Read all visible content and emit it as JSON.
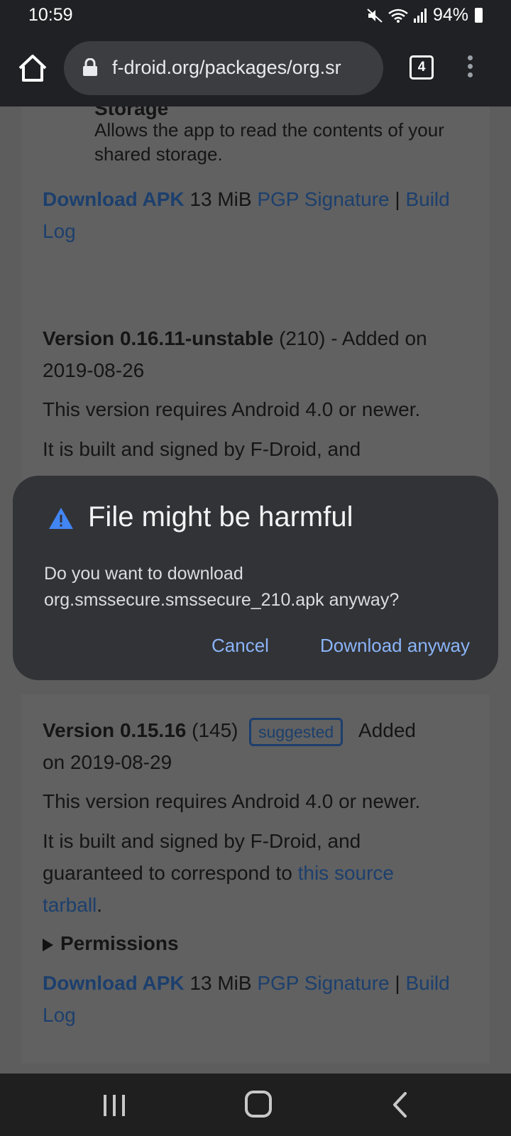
{
  "status_bar": {
    "time": "10:59",
    "battery": "94%"
  },
  "toolbar": {
    "url": "f-droid.org/packages/org.sr",
    "tab_count": "4"
  },
  "card_prev": {
    "permission_title": "Storage",
    "permission_desc_line1": "Allows the app to read the contents of your",
    "permission_desc_line2": "shared storage.",
    "download_apk": "Download APK",
    "size": "13 MiB",
    "pgp": "PGP Signature",
    "sep": "|",
    "build": "Build",
    "log": "Log"
  },
  "card_unstable": {
    "version": "Version 0.16.11-unstable",
    "code": "(210)",
    "added": "- Added on",
    "date": "2019-08-26",
    "requires": "This version requires Android 4.0 or newer.",
    "built": "It is built and signed by F-Droid, and"
  },
  "card_stable": {
    "version": "Version 0.15.16",
    "code": "(145)",
    "badge": "suggested",
    "added": "Added",
    "date": "on 2019-08-29",
    "requires": "This version requires Android 4.0 or newer.",
    "built": "It is built and signed by F-Droid, and",
    "guaranteed": "guaranteed to correspond to",
    "source_link1": "this source",
    "source_link2": "tarball",
    "period": ".",
    "permissions": "Permissions",
    "download_apk": "Download APK",
    "size": "13 MiB",
    "pgp": "PGP Signature",
    "sep": "|",
    "build": "Build",
    "log": "Log"
  },
  "dialog": {
    "title": "File might be harmful",
    "message_line1": "Do you want to download",
    "message_line2": "org.smssecure.smssecure_210.apk anyway?",
    "cancel": "Cancel",
    "download": "Download anyway"
  },
  "colors": {
    "link": "#1c3f6d",
    "dialog_bg": "#323336",
    "dialog_button": "#8ab4f8",
    "warning": "#4285f4"
  }
}
